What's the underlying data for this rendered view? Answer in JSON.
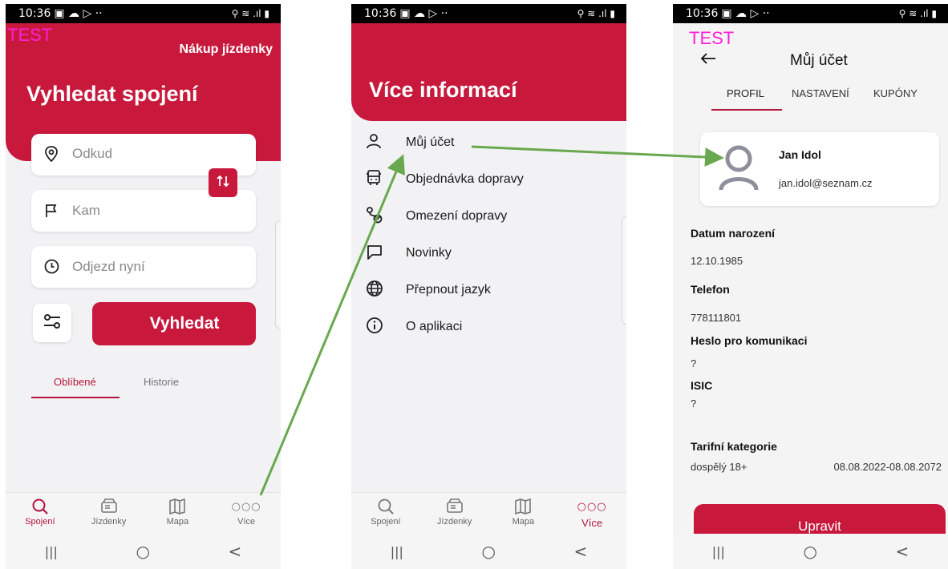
{
  "status": {
    "time": "10:36",
    "icons_left": "▣ ☁ ▷ ··",
    "icons_right": "⚲ ≋ .ıl ▮"
  },
  "test_label": "TEST",
  "sysnav": {
    "recents": "|||",
    "home": "○",
    "back": "<"
  },
  "bottom_tabs": [
    {
      "label": "Spojení",
      "icon": "search-icon"
    },
    {
      "label": "Jízdenky",
      "icon": "ticket-icon"
    },
    {
      "label": "Mapa",
      "icon": "map-icon"
    },
    {
      "label": "Více",
      "icon": "more-icon"
    }
  ],
  "screen1": {
    "buy_ticket": "Nákup jízdenky",
    "title": "Vyhledat spojení",
    "from_placeholder": "Odkud",
    "to_placeholder": "Kam",
    "departure_placeholder": "Odjezd nyní",
    "search_button": "Vyhledat",
    "tab_favorites": "Oblíbené",
    "tab_history": "Historie",
    "active_tab": "Spojení"
  },
  "screen2": {
    "title": "Více informací",
    "menu": [
      {
        "label": "Můj účet",
        "icon": "person-icon"
      },
      {
        "label": "Objednávka dopravy",
        "icon": "bus-icon"
      },
      {
        "label": "Omezení dopravy",
        "icon": "route-icon"
      },
      {
        "label": "Novinky",
        "icon": "chat-icon"
      },
      {
        "label": "Přepnout jazyk",
        "icon": "globe-icon"
      },
      {
        "label": "O aplikaci",
        "icon": "info-icon"
      }
    ],
    "active_tab": "Více"
  },
  "screen3": {
    "title": "Můj účet",
    "tabs": [
      "PROFIL",
      "NASTAVENÍ",
      "KUPÓNY"
    ],
    "active_tab": "PROFIL",
    "user_name": "Jan Idol",
    "user_email": "jan.idol@seznam.cz",
    "fields": [
      {
        "label": "Datum narození",
        "value": "12.10.1985"
      },
      {
        "label": "Telefon",
        "value": "778111801"
      },
      {
        "label": "Heslo pro komunikaci",
        "value": "?"
      },
      {
        "label": "ISIC",
        "value": "?"
      }
    ],
    "tariff_label": "Tarifní kategorie",
    "tariff_value": "dospělý 18+",
    "tariff_validity": "08.08.2022-08.08.2072",
    "edit_button": "Upravit"
  },
  "colors": {
    "brand_red": "#c8193d",
    "arrow_green": "#6aa84f",
    "test_magenta": "#ff1fd6"
  }
}
